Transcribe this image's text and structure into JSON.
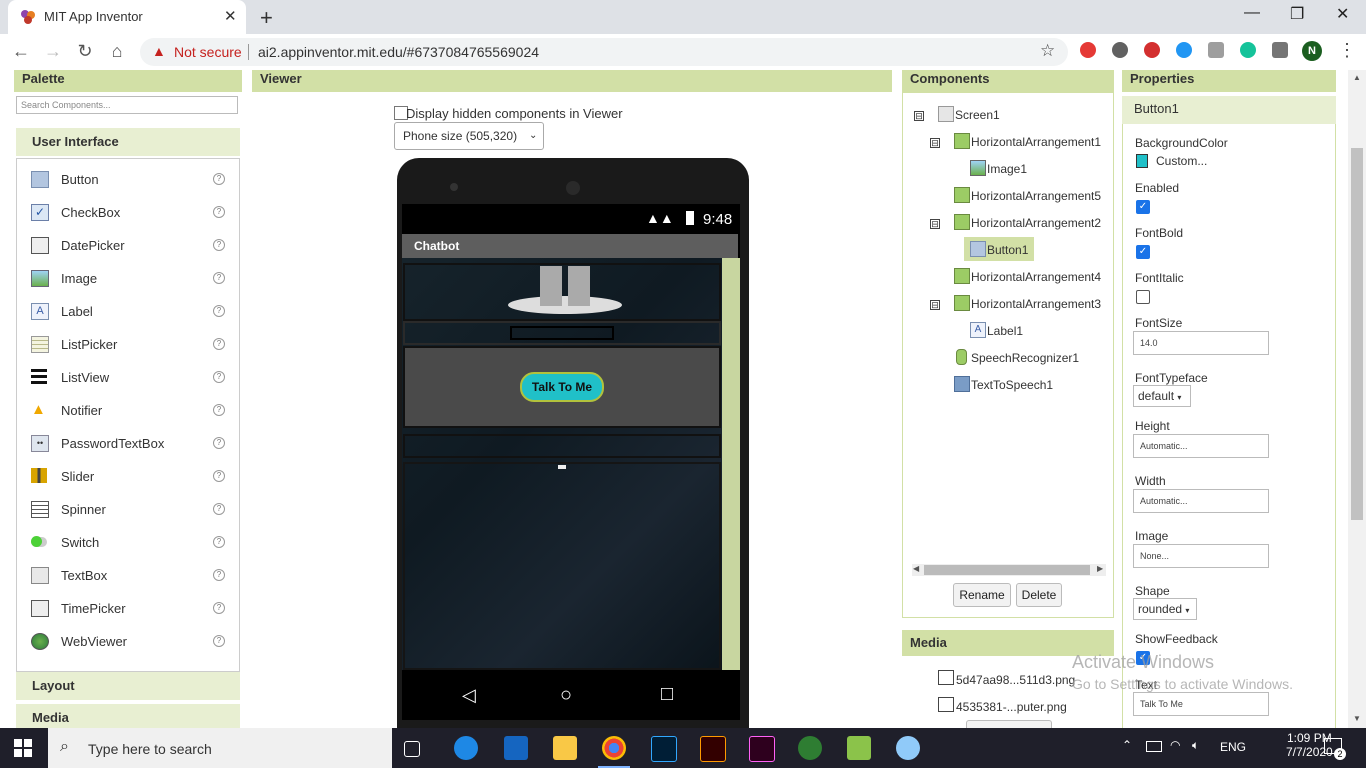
{
  "browser": {
    "tab_title": "MIT App Inventor",
    "not_secure": "Not secure",
    "url": "ai2.appinventor.mit.edu/#6737084765569024",
    "profile_initial": "N"
  },
  "palette": {
    "header": "Palette",
    "search_placeholder": "Search Components...",
    "section": "User Interface",
    "items": [
      {
        "label": "Button"
      },
      {
        "label": "CheckBox"
      },
      {
        "label": "DatePicker"
      },
      {
        "label": "Image"
      },
      {
        "label": "Label"
      },
      {
        "label": "ListPicker"
      },
      {
        "label": "ListView"
      },
      {
        "label": "Notifier"
      },
      {
        "label": "PasswordTextBox"
      },
      {
        "label": "Slider"
      },
      {
        "label": "Spinner"
      },
      {
        "label": "Switch"
      },
      {
        "label": "TextBox"
      },
      {
        "label": "TimePicker"
      },
      {
        "label": "WebViewer"
      }
    ],
    "help_glyph": "?",
    "layout_section": "Layout",
    "media_section": "Media"
  },
  "viewer": {
    "header": "Viewer",
    "hidden_label": "Display hidden components in Viewer",
    "phone_size": "Phone size (505,320)",
    "clock": "9:48",
    "screen_title": "Chatbot",
    "button_text": "Talk To Me"
  },
  "components": {
    "header": "Components",
    "tree": [
      {
        "label": "Screen1",
        "icon": "screen-icon",
        "expand": "⊟"
      },
      {
        "label": "HorizontalArrangement1",
        "icon": "arrangement-icon",
        "expand": "⊟"
      },
      {
        "label": "Image1",
        "icon": "image-icon",
        "expand": ""
      },
      {
        "label": "HorizontalArrangement5",
        "icon": "arrangement-icon",
        "expand": ""
      },
      {
        "label": "HorizontalArrangement2",
        "icon": "arrangement-icon",
        "expand": "⊟"
      },
      {
        "label": "Button1",
        "icon": "button-icon",
        "expand": ""
      },
      {
        "label": "HorizontalArrangement4",
        "icon": "arrangement-icon",
        "expand": ""
      },
      {
        "label": "HorizontalArrangement3",
        "icon": "arrangement-icon",
        "expand": "⊟"
      },
      {
        "label": "Label1",
        "icon": "label-icon",
        "expand": ""
      },
      {
        "label": "SpeechRecognizer1",
        "icon": "speech-recognizer-icon",
        "expand": ""
      },
      {
        "label": "TextToSpeech1",
        "icon": "text-to-speech-icon",
        "expand": ""
      }
    ],
    "rename": "Rename",
    "delete": "Delete"
  },
  "media": {
    "header": "Media",
    "files": [
      "5d47aa98...511d3.png",
      "4535381-...puter.png"
    ]
  },
  "properties": {
    "header": "Properties",
    "component": "Button1",
    "background_color_label": "BackgroundColor",
    "background_color_value": "Custom...",
    "enabled_label": "Enabled",
    "fontbold_label": "FontBold",
    "fontitalic_label": "FontItalic",
    "fontsize_label": "FontSize",
    "fontsize_value": "14.0",
    "fonttypeface_label": "FontTypeface",
    "fonttypeface_value": "default",
    "height_label": "Height",
    "height_value": "Automatic...",
    "width_label": "Width",
    "width_value": "Automatic...",
    "image_label": "Image",
    "image_value": "None...",
    "shape_label": "Shape",
    "shape_value": "rounded",
    "showfeedback_label": "ShowFeedback",
    "text_label": "Text",
    "text_value": "Talk To Me"
  },
  "watermark": {
    "line1": "Activate Windows",
    "line2": "Go to Settings to activate Windows."
  },
  "taskbar": {
    "search": "Type here to search",
    "language": "ENG",
    "time": "1:09 PM",
    "date": "7/7/2020",
    "notifications": "2"
  },
  "colors": {
    "panel_header": "#d2e0a6",
    "button_bg": "#20c0c8",
    "accent": "#1a73e8"
  }
}
